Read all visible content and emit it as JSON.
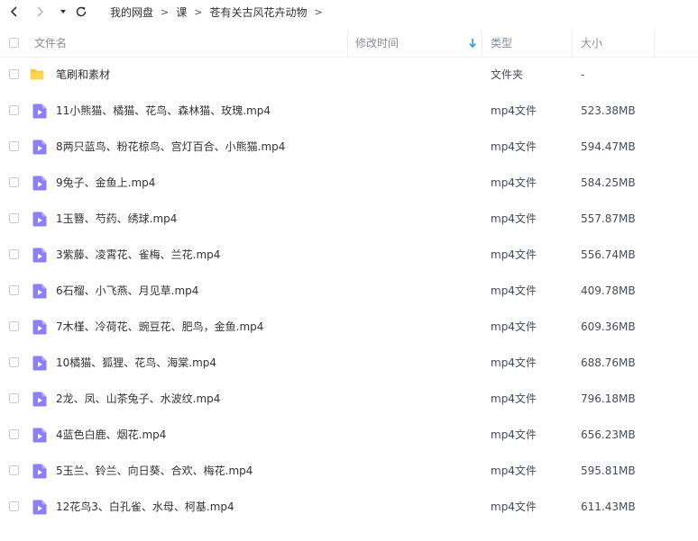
{
  "breadcrumb": {
    "items": [
      "我的网盘",
      "课",
      "苍有关古风花卉动物"
    ],
    "separator": ">"
  },
  "columns": {
    "name": "文件名",
    "modified": "修改时间",
    "type": "类型",
    "size": "大小"
  },
  "files": [
    {
      "name": "笔刷和素材",
      "type": "文件夹",
      "size": "-",
      "icon": "folder-icon"
    },
    {
      "name": "11小熊猫、橘猫、花鸟、森林猫、玫瑰.mp4",
      "type": "mp4文件",
      "size": "523.38MB",
      "icon": "video-file-icon"
    },
    {
      "name": "8两只蓝鸟、粉花椋鸟、宫灯百合、小熊猫.mp4",
      "type": "mp4文件",
      "size": "594.47MB",
      "icon": "video-file-icon"
    },
    {
      "name": "9兔子、金鱼上.mp4",
      "type": "mp4文件",
      "size": "584.25MB",
      "icon": "video-file-icon"
    },
    {
      "name": "1玉簪、芍药、绣球.mp4",
      "type": "mp4文件",
      "size": "557.87MB",
      "icon": "video-file-icon"
    },
    {
      "name": "3紫藤、凌霄花、雀梅、兰花.mp4",
      "type": "mp4文件",
      "size": "556.74MB",
      "icon": "video-file-icon"
    },
    {
      "name": "6石榴、小飞燕、月见草.mp4",
      "type": "mp4文件",
      "size": "409.78MB",
      "icon": "video-file-icon"
    },
    {
      "name": "7木槿、冷荷花、豌豆花、肥鸟，金鱼.mp4",
      "type": "mp4文件",
      "size": "609.36MB",
      "icon": "video-file-icon"
    },
    {
      "name": "10橘猫、狐狸、花鸟、海棠.mp4",
      "type": "mp4文件",
      "size": "688.76MB",
      "icon": "video-file-icon"
    },
    {
      "name": "2龙、凤、山茶兔子、水波纹.mp4",
      "type": "mp4文件",
      "size": "796.18MB",
      "icon": "video-file-icon"
    },
    {
      "name": "4蓝色白鹿、烟花.mp4",
      "type": "mp4文件",
      "size": "656.23MB",
      "icon": "video-file-icon"
    },
    {
      "name": "5玉兰、铃兰、向日葵、合欢、梅花.mp4",
      "type": "mp4文件",
      "size": "595.81MB",
      "icon": "video-file-icon"
    },
    {
      "name": "12花鸟3、白孔雀、水母、柯基.mp4",
      "type": "mp4文件",
      "size": "611.43MB",
      "icon": "video-file-icon"
    }
  ],
  "colors": {
    "accent": "#1f8fff",
    "folder": "#ffc83d",
    "video_icon": "#8b80f9",
    "header_text": "#878c9c"
  }
}
